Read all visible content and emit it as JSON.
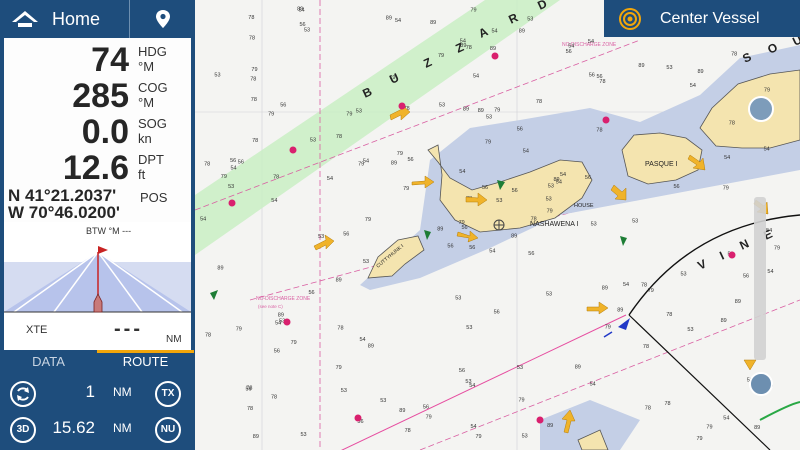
{
  "header": {
    "home_label": "Home",
    "center_vessel_label": "Center Vessel"
  },
  "nav": {
    "hdg": {
      "value": "74",
      "label": "HDG",
      "unit": "°M"
    },
    "cog": {
      "value": "285",
      "label": "COG",
      "unit": "°M"
    },
    "sog": {
      "value": "0.0",
      "label": "SOG",
      "unit": "kn"
    },
    "dpt": {
      "value": "12.6",
      "label": "DPT",
      "unit": "ft"
    },
    "pos": {
      "lat": "N 41°21.2037'",
      "lon": "W 70°46.0200'",
      "label": "POS"
    }
  },
  "highway": {
    "btw_label": "BTW °M",
    "btw_value": "---",
    "xte_label": "XTE",
    "xte_value": "---",
    "xte_unit": "NM"
  },
  "tabs": {
    "data": "DATA",
    "route": "ROUTE"
  },
  "route": {
    "row1": {
      "value": "1",
      "unit": "NM",
      "badge": "TX"
    },
    "row2": {
      "left_badge": "3D",
      "value": "15.62",
      "unit": "NM",
      "badge": "NU"
    }
  },
  "chart": {
    "buzzards": [
      "B",
      "U",
      "Z",
      "Z",
      "A",
      "R",
      "D",
      "S"
    ],
    "vineyard": [
      "V",
      "I",
      "N",
      "E",
      "Y",
      "A",
      "R",
      "D"
    ],
    "sound_letters": [
      "S",
      "O",
      "U"
    ],
    "nashawena": "NASHAWENA I",
    "pasque": "PASQUE I",
    "cuttyhunk": "CUTTYHUNK I",
    "nodischarge": "NO-DISCHARGE ZONE",
    "nodischarge_sub": "(see note C)",
    "house": "HOUSE",
    "depth_pairs": [
      [
        "54",
        "63"
      ],
      [
        "74",
        "79"
      ],
      [
        "56",
        "66"
      ],
      [
        "83",
        "78"
      ],
      [
        "53",
        "61"
      ],
      [
        "92",
        "89"
      ]
    ]
  }
}
